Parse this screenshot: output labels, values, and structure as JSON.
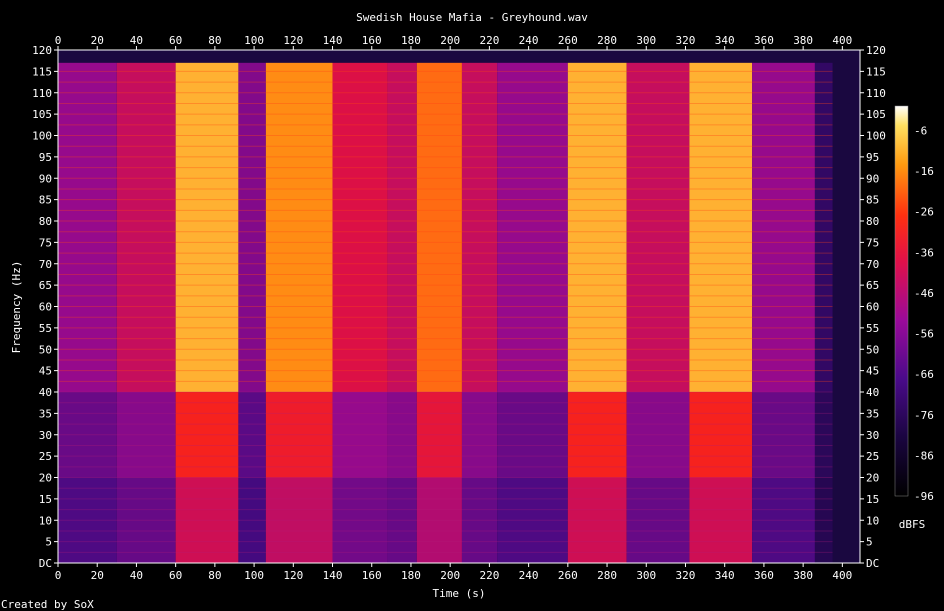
{
  "chart_data": {
    "type": "heatmap",
    "title": "Swedish House Mafia - Greyhound.wav",
    "xlabel": "Time (s)",
    "ylabel": "Frequency (Hz)",
    "xlim": [
      0,
      409
    ],
    "ylim": [
      0,
      120
    ],
    "x_ticks": [
      "0",
      "20",
      "40",
      "60",
      "80",
      "100",
      "120",
      "140",
      "160",
      "180",
      "200",
      "220",
      "240",
      "260",
      "280",
      "300",
      "320",
      "340",
      "360",
      "380",
      "400"
    ],
    "y_ticks": [
      "DC",
      "5",
      "10",
      "15",
      "20",
      "25",
      "30",
      "35",
      "40",
      "45",
      "50",
      "55",
      "60",
      "65",
      "70",
      "75",
      "80",
      "85",
      "90",
      "95",
      "100",
      "105",
      "110",
      "115",
      "120"
    ],
    "colorbar": {
      "unit": "dBFS",
      "ticks": [
        "-6",
        "-16",
        "-26",
        "-36",
        "-46",
        "-56",
        "-66",
        "-76",
        "-86",
        "-96"
      ],
      "range": [
        -96,
        0
      ]
    },
    "segments": [
      {
        "start": 0,
        "end": 30,
        "level": 0.45
      },
      {
        "start": 30,
        "end": 60,
        "level": 0.55
      },
      {
        "start": 60,
        "end": 92,
        "level": 0.95
      },
      {
        "start": 92,
        "end": 106,
        "level": 0.4
      },
      {
        "start": 106,
        "end": 140,
        "level": 0.9
      },
      {
        "start": 140,
        "end": 168,
        "level": 0.6
      },
      {
        "start": 168,
        "end": 183,
        "level": 0.55
      },
      {
        "start": 183,
        "end": 206,
        "level": 0.85
      },
      {
        "start": 206,
        "end": 224,
        "level": 0.55
      },
      {
        "start": 224,
        "end": 260,
        "level": 0.45
      },
      {
        "start": 260,
        "end": 290,
        "level": 0.95
      },
      {
        "start": 290,
        "end": 322,
        "level": 0.55
      },
      {
        "start": 322,
        "end": 354,
        "level": 0.95
      },
      {
        "start": 354,
        "end": 386,
        "level": 0.45
      },
      {
        "start": 386,
        "end": 395,
        "level": 0.15
      }
    ]
  },
  "credit": "Created by SoX"
}
